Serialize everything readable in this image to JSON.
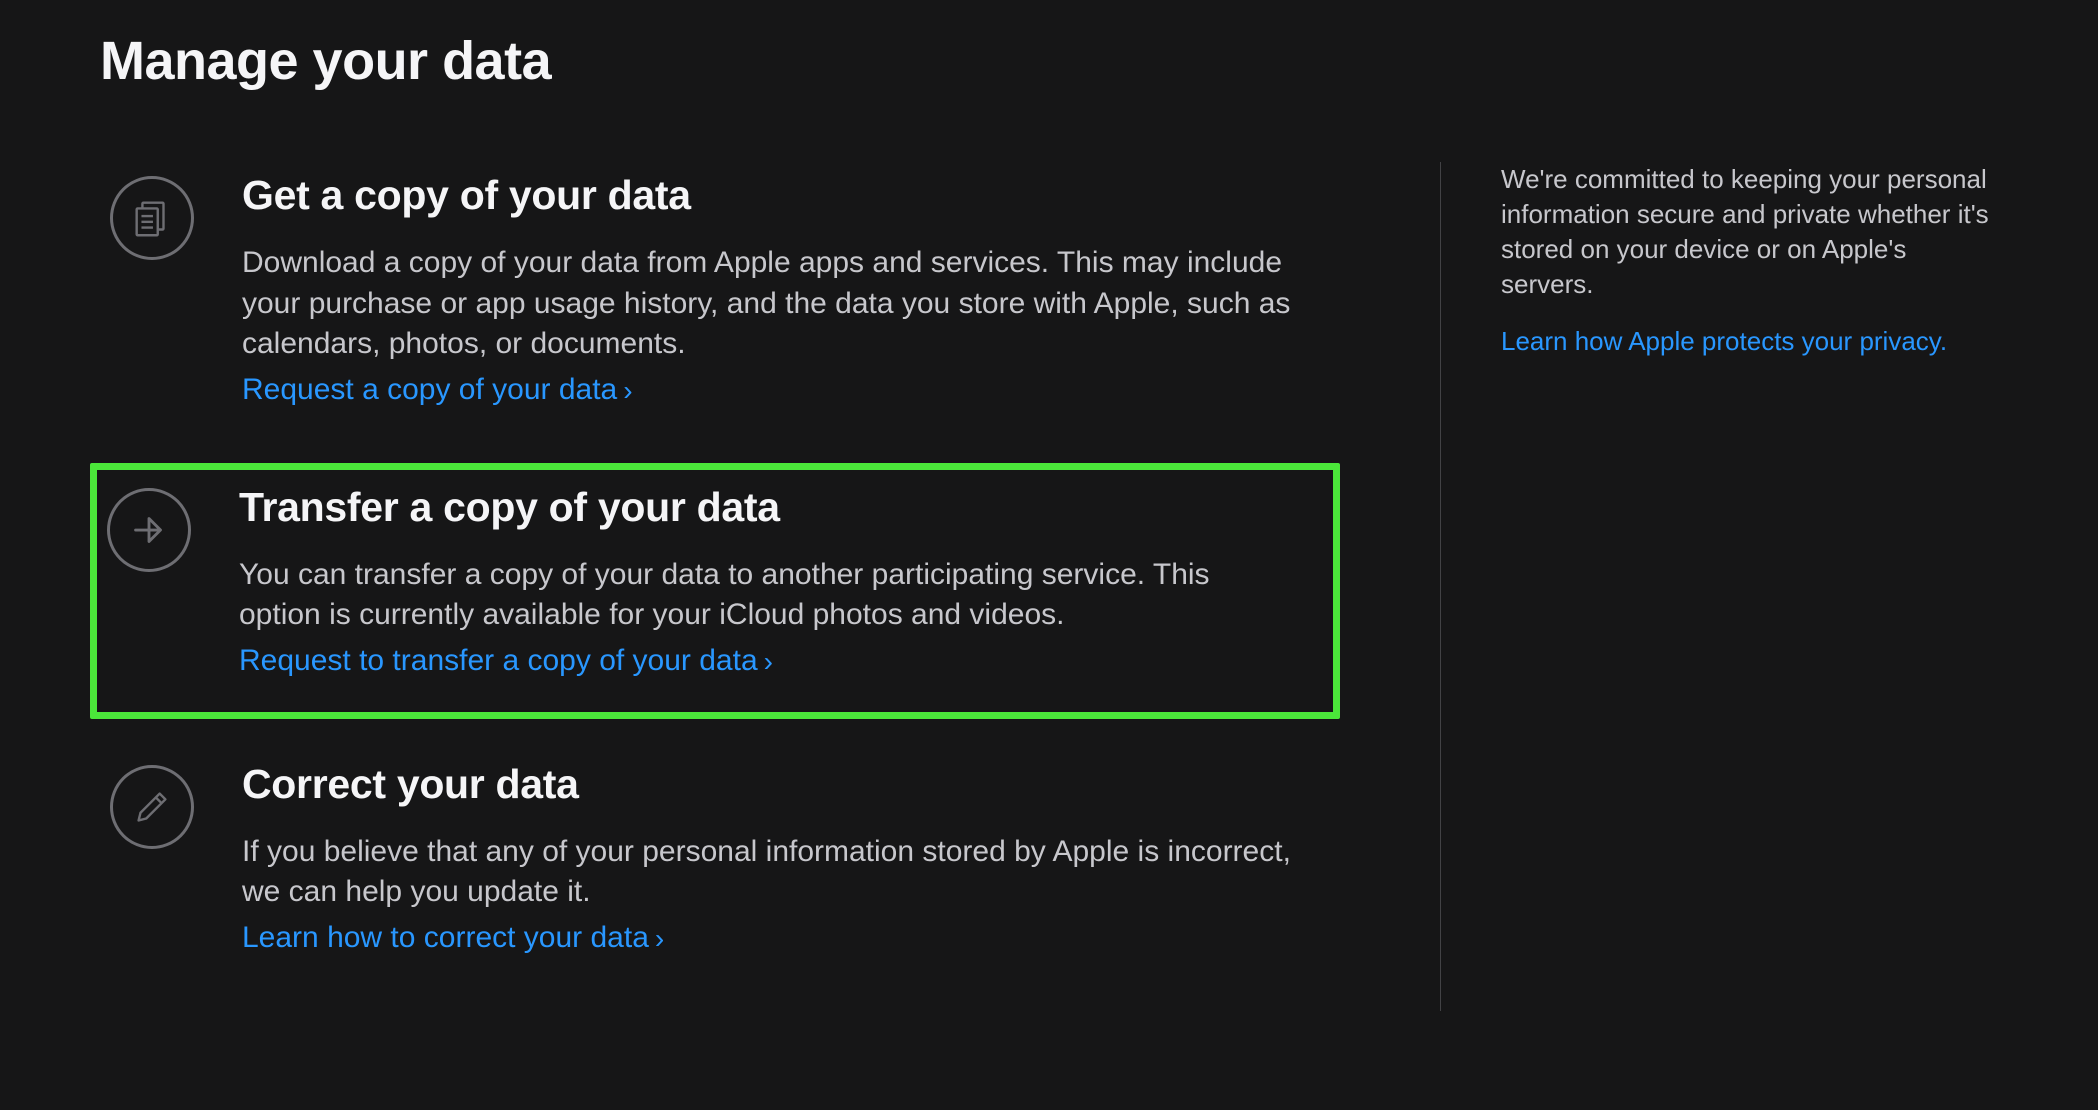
{
  "page": {
    "title": "Manage your data"
  },
  "sections": [
    {
      "title": "Get a copy of your data",
      "description": "Download a copy of your data from Apple apps and services. This may include your purchase or app usage history, and the data you store with Apple, such as calendars, photos, or documents.",
      "link": "Request a copy of your data",
      "highlighted": false
    },
    {
      "title": "Transfer a copy of your data",
      "description": "You can transfer a copy of your data to another participating service. This option is currently available for your iCloud photos and videos.",
      "link": "Request to transfer a copy of your data",
      "highlighted": true
    },
    {
      "title": "Correct your data",
      "description": "If you believe that any of your personal information stored by Apple is incorrect, we can help you update it.",
      "link": "Learn how to correct your data",
      "highlighted": false
    }
  ],
  "sidebar": {
    "text": "We're committed to keeping your personal information secure and private whether it's stored on your device or on Apple's servers.",
    "link": "Learn how Apple protects your privacy."
  },
  "colors": {
    "background": "#161617",
    "text": "#c7c7cc",
    "heading": "#f5f5f7",
    "link": "#2997ff",
    "highlight": "#4be83a",
    "icon": "#6e6e73"
  }
}
